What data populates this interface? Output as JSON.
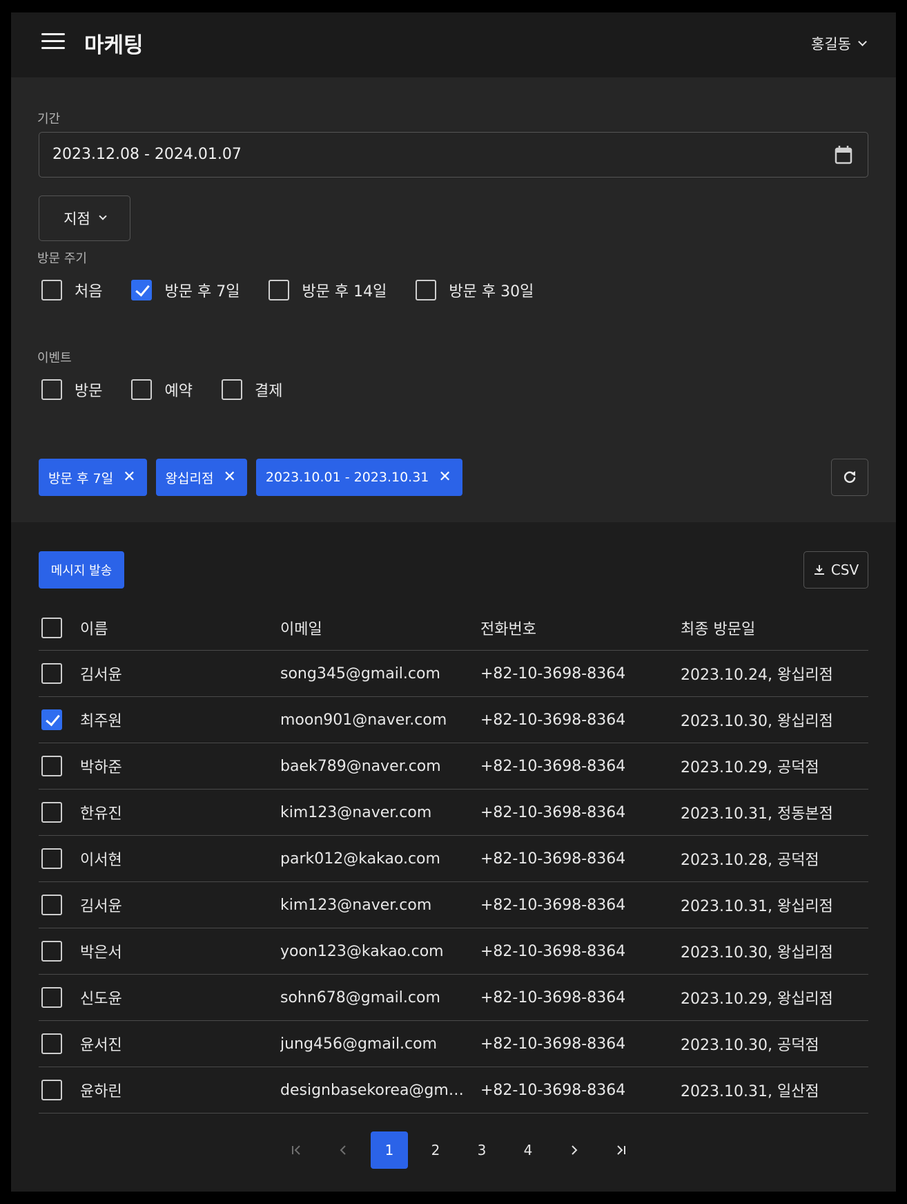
{
  "header": {
    "title": "마케팅",
    "user": "홍길동"
  },
  "filters": {
    "period_label": "기간",
    "period_value": "2023.12.08 - 2024.01.07",
    "branch_label": "지점",
    "visit_cycle_label": "방문 주기",
    "visit_cycle_options": [
      {
        "label": "처음",
        "checked": false
      },
      {
        "label": "방문 후 7일",
        "checked": true
      },
      {
        "label": "방문 후 14일",
        "checked": false
      },
      {
        "label": "방문 후 30일",
        "checked": false
      }
    ],
    "event_label": "이벤트",
    "event_options": [
      {
        "label": "방문",
        "checked": false
      },
      {
        "label": "예약",
        "checked": false
      },
      {
        "label": "결제",
        "checked": false
      }
    ],
    "chips": [
      "방문 후 7일",
      "왕십리점",
      "2023.10.01 - 2023.10.31"
    ]
  },
  "actions": {
    "send_message": "메시지 발송",
    "csv": "CSV"
  },
  "table": {
    "columns": [
      "이름",
      "이메일",
      "전화번호",
      "최종 방문일"
    ],
    "rows": [
      {
        "checked": false,
        "name": "김서윤",
        "email": "song345@gmail.com",
        "phone": "+82-10-3698-8364",
        "last_visit": "2023.10.24, 왕십리점"
      },
      {
        "checked": true,
        "name": "최주원",
        "email": "moon901@naver.com",
        "phone": "+82-10-3698-8364",
        "last_visit": "2023.10.30, 왕십리점"
      },
      {
        "checked": false,
        "name": "박하준",
        "email": "baek789@naver.com",
        "phone": "+82-10-3698-8364",
        "last_visit": "2023.10.29, 공덕점"
      },
      {
        "checked": false,
        "name": "한유진",
        "email": "kim123@naver.com",
        "phone": "+82-10-3698-8364",
        "last_visit": "2023.10.31, 정동본점"
      },
      {
        "checked": false,
        "name": "이서현",
        "email": "park012@kakao.com",
        "phone": "+82-10-3698-8364",
        "last_visit": "2023.10.28, 공덕점"
      },
      {
        "checked": false,
        "name": "김서윤",
        "email": "kim123@naver.com",
        "phone": "+82-10-3698-8364",
        "last_visit": "2023.10.31, 왕십리점"
      },
      {
        "checked": false,
        "name": "박은서",
        "email": "yoon123@kakao.com",
        "phone": "+82-10-3698-8364",
        "last_visit": "2023.10.30, 왕십리점"
      },
      {
        "checked": false,
        "name": "신도윤",
        "email": "sohn678@gmail.com",
        "phone": "+82-10-3698-8364",
        "last_visit": "2023.10.29, 왕십리점"
      },
      {
        "checked": false,
        "name": "윤서진",
        "email": "jung456@gmail.com",
        "phone": "+82-10-3698-8364",
        "last_visit": "2023.10.30, 공덕점"
      },
      {
        "checked": false,
        "name": "윤하린",
        "email": "designbasekorea@gm…",
        "phone": "+82-10-3698-8364",
        "last_visit": "2023.10.31, 일산점"
      }
    ]
  },
  "pagination": {
    "pages": [
      "1",
      "2",
      "3",
      "4"
    ],
    "current": "1"
  },
  "colors": {
    "accent": "#2b63e8",
    "panel": "#262626",
    "background": "#1d1d1d"
  }
}
